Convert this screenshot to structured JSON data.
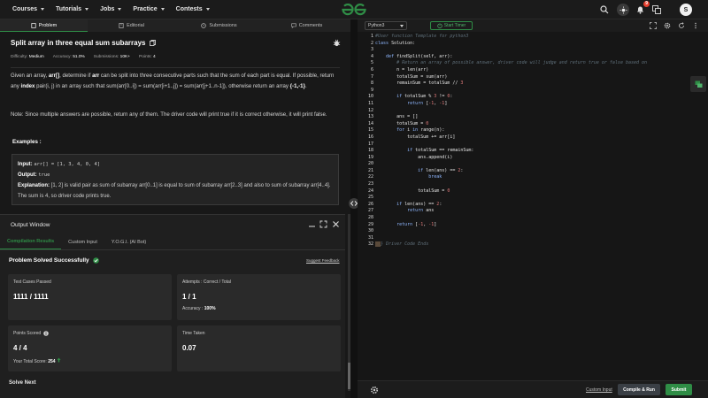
{
  "nav": {
    "links": [
      "Courses",
      "Tutorials",
      "Jobs",
      "Practice",
      "Contests"
    ],
    "notification_count": "9",
    "avatar_letter": "S"
  },
  "tabs": [
    "Problem",
    "Editorial",
    "Submissions",
    "Comments"
  ],
  "problem": {
    "title": "Split array in three equal sum subarrays",
    "difficulty_label": "Difficulty:",
    "difficulty": "Medium",
    "accuracy_label": "Accuracy:",
    "accuracy": "51.0%",
    "submissions_label": "Submissions:",
    "submissions": "10K+",
    "points_label": "Points:",
    "points": "4",
    "desc": {
      "t1": "Given an array,",
      "arr": "arr[]",
      "t2": ", determine if",
      "arr2": "arr",
      "t3": "can be split into three consecutive parts such that the sum of each part is equal. If possible, return any",
      "index": "index",
      "t4": "pair(i, j) in an array such that sum(arr[0..i]) = sum(arr[i+1..j]) = sum(arr[j+1..n-1]), otherwise return an array",
      "neg": "{-1,-1}",
      "t5": "."
    },
    "note": "Note: Since multiple answers are possible, return any of them. The driver code will print true if it is correct otherwise, it will print false.",
    "examples_label": "Examples :",
    "example": {
      "input_label": "Input:",
      "input": "arr[] = [1, 3, 4, 0, 4]",
      "output_label": "Output:",
      "output": "true",
      "explanation_label": "Explanation:",
      "explanation": "[1, 2] is valid pair as sum of subarray arr[0..1] is equal to sum of subarray arr[2..3] and also to sum of subarray arr[4..4]. The sum is 4, so driver code prints true."
    }
  },
  "output_window": {
    "title": "Output Window",
    "tabs": [
      "Compilation Results",
      "Custom Input",
      "Y.O.G.I. (AI Bot)"
    ],
    "status": "Problem Solved Successfully",
    "feedback": "Suggest Feedback",
    "test_cases_label": "Test Cases Passed",
    "test_cases": "1111 / 1111",
    "attempts_label": "Attempts : Correct / Total",
    "attempts": "1 / 1",
    "accuracy_label": "Accuracy :",
    "accuracy": "100%",
    "points_label": "Points Scored",
    "points": "4 / 4",
    "total_score_label": "Your Total Score:",
    "total_score": "254",
    "time_label": "Time Taken",
    "time": "0.07",
    "solve_next": "Solve Next"
  },
  "editor": {
    "language": "Python3",
    "timer_label": "Start Timer",
    "custom_input": "Custom Input",
    "compile_run": "Compile & Run",
    "submit": "Submit",
    "code_lines": [
      "#User function Template for python3",
      "class Solution:",
      "",
      "    def findSplit(self, arr):",
      "        # Return an array of possible answer, driver code will judge and return true or false based on",
      "        n = len(arr)",
      "        totalSum = sum(arr)",
      "        remainSum = totalSum // 3",
      "",
      "        if totalSum % 3 != 0:",
      "            return [-1, -1]",
      "",
      "        ans = []",
      "        totalSum = 0",
      "        for i in range(n):",
      "            totalSum += arr[i]",
      "",
      "            if totalSum == remainSum:",
      "                ans.append(i)",
      "",
      "                if len(ans) == 2:",
      "                    break",
      "",
      "                totalSum = 0",
      "",
      "        if len(ans) == 2:",
      "            return ans",
      "",
      "        return [-1, -1]",
      "",
      "",
      "#} Driver Code Ends"
    ]
  }
}
